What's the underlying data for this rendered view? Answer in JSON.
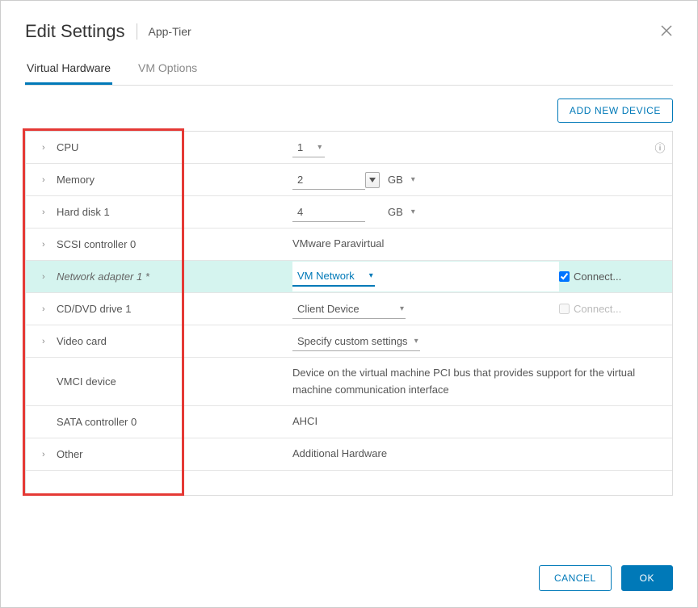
{
  "header": {
    "title": "Edit Settings",
    "subtitle": "App-Tier"
  },
  "tabs": {
    "hardware": "Virtual Hardware",
    "options": "VM Options"
  },
  "actions": {
    "add_device": "ADD NEW DEVICE"
  },
  "rows": {
    "cpu": {
      "label": "CPU",
      "value": "1"
    },
    "memory": {
      "label": "Memory",
      "value": "2",
      "unit": "GB"
    },
    "hdd": {
      "label": "Hard disk 1",
      "value": "4",
      "unit": "GB"
    },
    "scsi": {
      "label": "SCSI controller 0",
      "value": "VMware Paravirtual"
    },
    "net": {
      "label": "Network adapter 1 *",
      "value": "VM Network",
      "connect": "Connect..."
    },
    "cddvd": {
      "label": "CD/DVD drive 1",
      "value": "Client Device",
      "connect": "Connect..."
    },
    "video": {
      "label": "Video card",
      "value": "Specify custom settings"
    },
    "vmci": {
      "label": "VMCI device",
      "value": "Device on the virtual machine PCI bus that provides support for the virtual machine communication interface"
    },
    "sata": {
      "label": "SATA controller 0",
      "value": "AHCI"
    },
    "other": {
      "label": "Other",
      "value": "Additional Hardware"
    }
  },
  "footer": {
    "cancel": "CANCEL",
    "ok": "OK"
  }
}
